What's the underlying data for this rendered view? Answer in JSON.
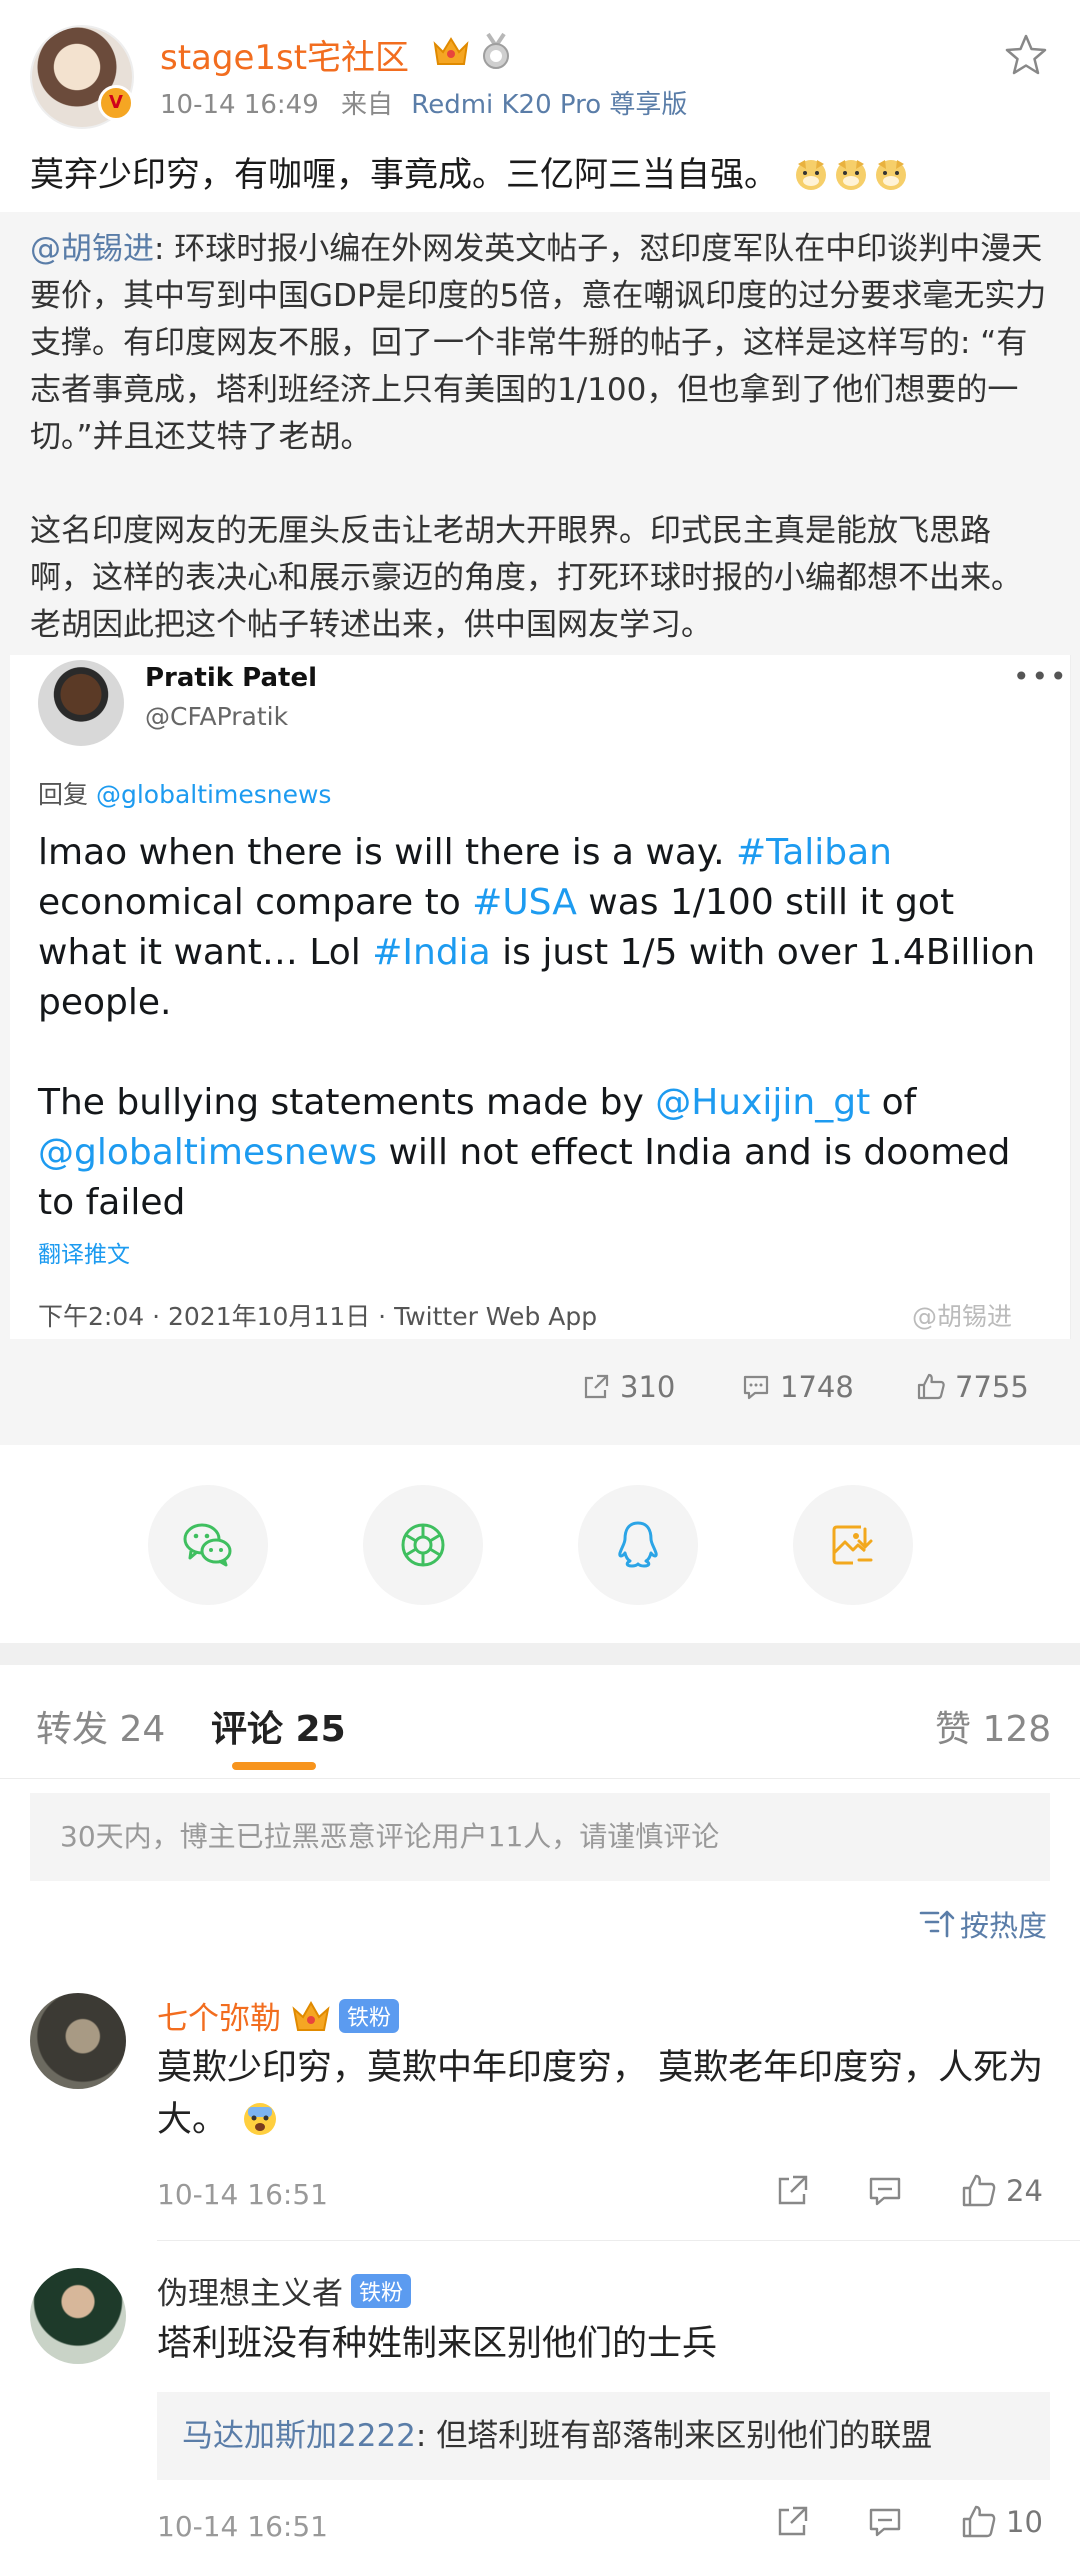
{
  "post": {
    "author": "stage1st宅社区",
    "time": "10-14 16:49",
    "source_prefix": "来自",
    "device": "Redmi K20 Pro 尊享版",
    "verified_badge": "V",
    "text": "莫弃少印穷，有咖喱，事竟成。三亿阿三当自强。"
  },
  "repost": {
    "mention": "@胡锡进",
    "text": ": 环球时报小编在外网发英文帖子，怼印度军队在中印谈判中漫天要价，其中写到中国GDP是印度的5倍，意在嘲讽印度的过分要求毫无实力支撑。有印度网友不服，回了一个非常牛掰的帖子，这样是这样写的: “有志者事竟成，塔利班经济上只有美国的1/100，但也拿到了他们想要的一切。”并且还艾特了老胡。\n\n这名印度网友的无厘头反击让老胡大开眼界。印式民主真是能放飞思路啊，这样的表决心和展示豪迈的角度，打死环球时报的小编都想不出来。老胡因此把这个帖子转述出来，供中国网友学习。",
    "tweet": {
      "name": "Pratik Patel",
      "handle": "@CFAPratik",
      "more": "•••",
      "reply_prefix": "回复",
      "reply_to": "@globaltimesnews",
      "p1_a": "lmao when there is will there is a way. ",
      "p1_tag1": "#Taliban",
      "p1_b": " economical compare to ",
      "p1_tag2": "#USA",
      "p1_c": " was 1/100 still it got what it want… Lol ",
      "p1_tag3": "#India",
      "p1_d": " is just 1/5 with over 1.4Billion people.",
      "p2_a": "The bullying statements made by ",
      "p2_tag1": "@Huxijin_gt",
      "p2_b": " of ",
      "p2_tag2": "@globaltimesnews",
      "p2_c": " will not effect India and is doomed to failed",
      "translate": "翻译推文",
      "time": "下午2:04 · 2021年10月11日 · Twitter Web App",
      "watermark": "@胡锡进"
    },
    "stats": {
      "reposts": "310",
      "comments": "1748",
      "likes": "7755"
    }
  },
  "share": [
    "wechat-icon",
    "moments-icon",
    "qq-icon",
    "save-image-icon"
  ],
  "tabs": {
    "repost": "转发 24",
    "comments": "评论 25",
    "likes": "赞 128"
  },
  "notice": "30天内，博主已拉黑恶意评论用户11人，请谨慎评论",
  "sort_label": "按热度",
  "comments": [
    {
      "name": "七个弥勒",
      "badge": "铁粉",
      "text": "莫欺少印穷，莫欺中年印度穷， 莫欺老年印度穷，人死为大。",
      "time": "10-14 16:51",
      "likes": "24"
    },
    {
      "name": "伪理想主义者",
      "badge": "铁粉",
      "text": "塔利班没有种姓制来区别他们的士兵",
      "reply_mention": "马达加斯加2222",
      "reply_text": ": 但塔利班有部落制来区别他们的联盟",
      "time": "10-14 16:51",
      "likes": "10"
    }
  ],
  "colors": {
    "accent": "#f26d1f",
    "link": "#5a7da8",
    "twitter": "#1d9bf0",
    "tab_underline": "#f7941d"
  }
}
